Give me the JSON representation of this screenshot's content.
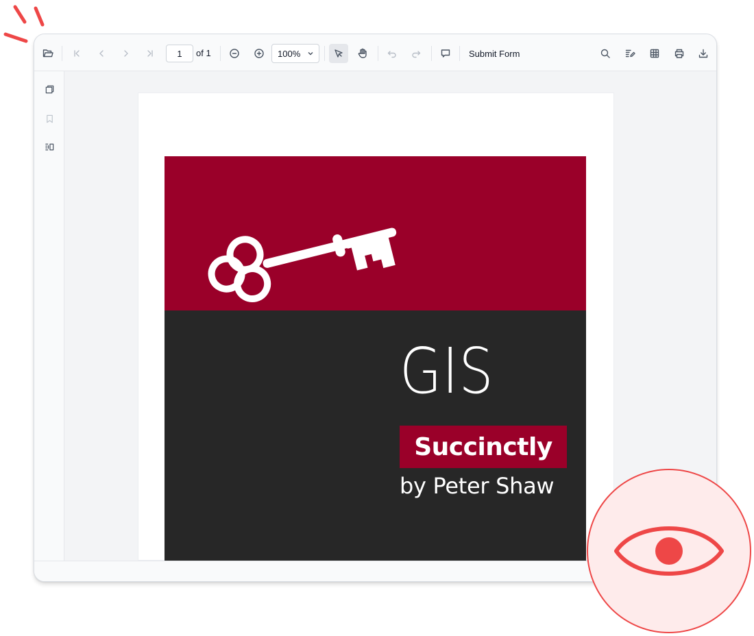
{
  "toolbar": {
    "page_number": "1",
    "page_of": "of 1",
    "zoom": "100%",
    "submit_label": "Submit Form"
  },
  "document": {
    "cover_title": "GIS",
    "cover_subtitle": "Succinctly",
    "cover_author": "by Peter Shaw"
  },
  "colors": {
    "cover_red": "#9a0029",
    "cover_dark": "#272727",
    "accent_red": "#ee4747"
  },
  "icons": {
    "toolbar": [
      "folder-open-icon",
      "first-page-icon",
      "previous-page-icon",
      "next-page-icon",
      "last-page-icon",
      "zoom-out-icon",
      "zoom-in-icon",
      "chevron-down-icon",
      "text-select-icon",
      "pan-hand-icon",
      "undo-icon",
      "redo-icon",
      "comment-icon",
      "search-icon",
      "annotation-icon",
      "form-designer-icon",
      "print-icon",
      "download-icon"
    ],
    "sidebar": [
      "page-thumbnails-icon",
      "bookmark-icon",
      "organize-pages-icon"
    ],
    "overlay": "eye-icon"
  }
}
